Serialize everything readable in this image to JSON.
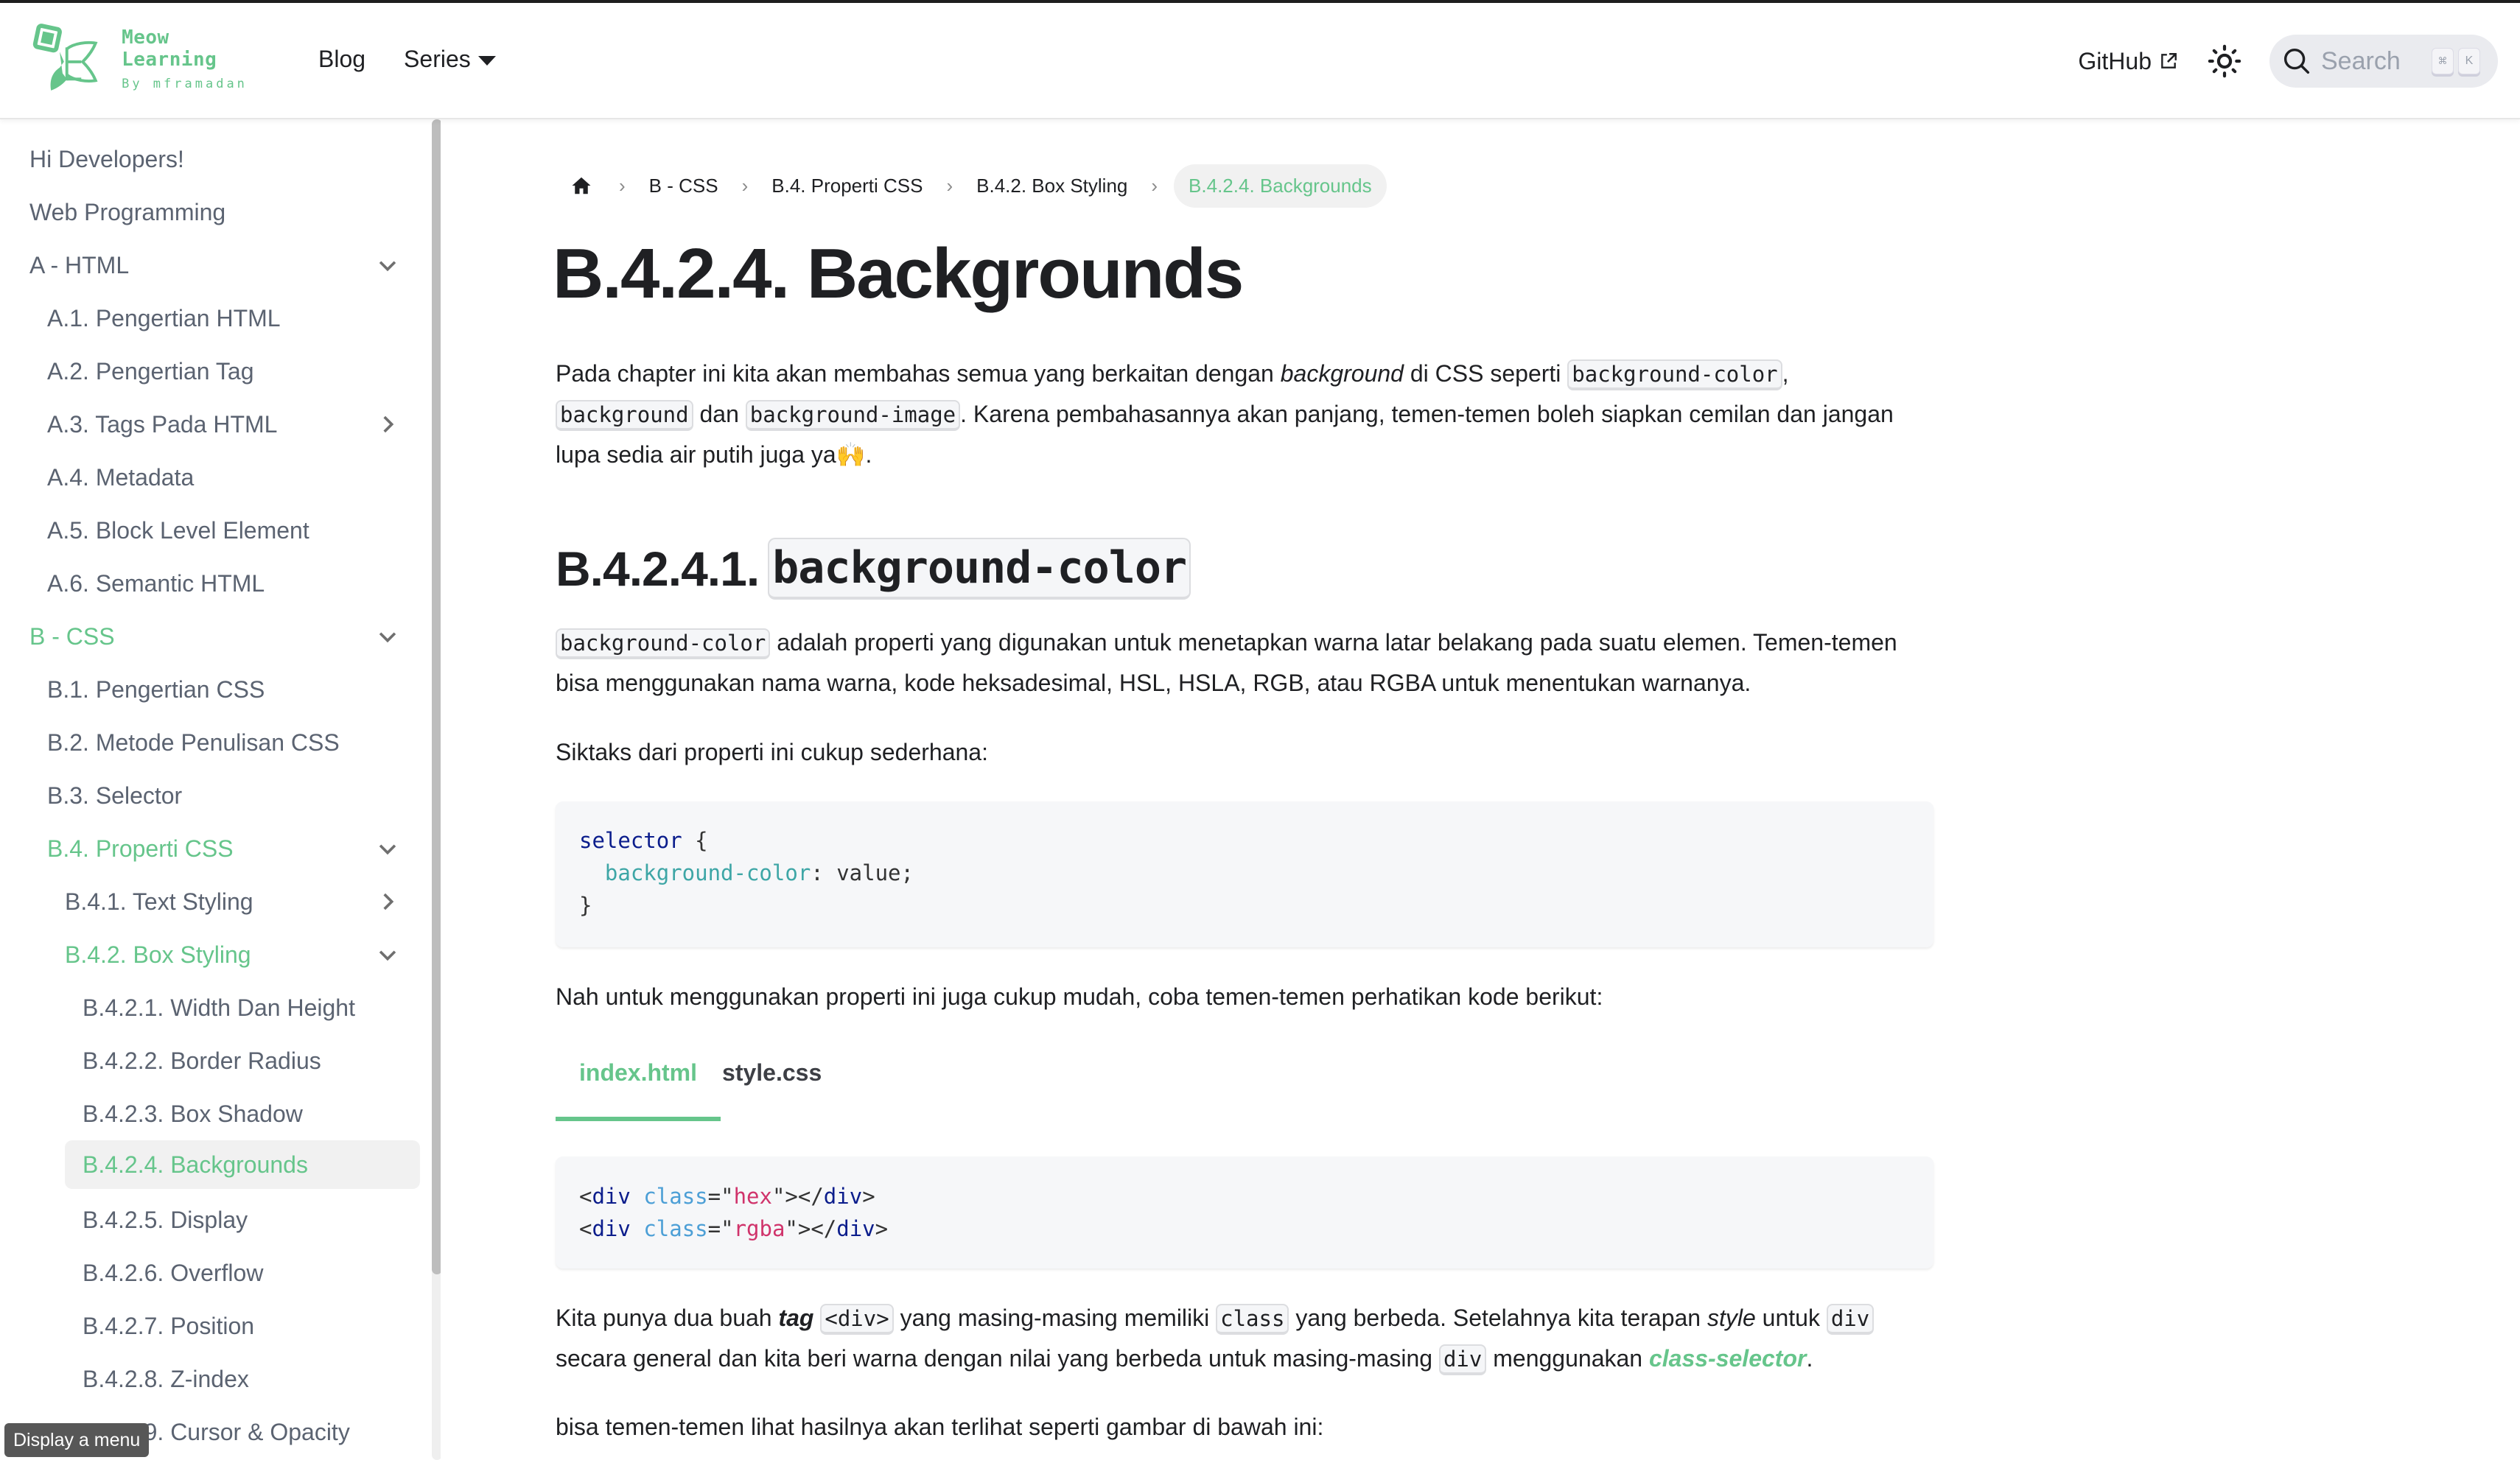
{
  "header": {
    "logo_title": "Meow Learning",
    "logo_subtitle": "By mframadan",
    "nav": {
      "blog": "Blog",
      "series": "Series"
    },
    "github": "GitHub",
    "search": {
      "placeholder": "Search",
      "shortcut_modifier": "⌘",
      "shortcut_key": "K"
    }
  },
  "sidebar": {
    "items": [
      {
        "label": "Hi Developers!"
      },
      {
        "label": "Web Programming"
      },
      {
        "label": "A - HTML",
        "expanded": true
      },
      {
        "label": "A.1. Pengertian HTML"
      },
      {
        "label": "A.2. Pengertian Tag"
      },
      {
        "label": "A.3. Tags Pada HTML",
        "expanded": false
      },
      {
        "label": "A.4. Metadata"
      },
      {
        "label": "A.5. Block Level Element"
      },
      {
        "label": "A.6. Semantic HTML"
      },
      {
        "label": "B - CSS",
        "expanded": true,
        "highlighted": true
      },
      {
        "label": "B.1. Pengertian CSS"
      },
      {
        "label": "B.2. Metode Penulisan CSS"
      },
      {
        "label": "B.3. Selector"
      },
      {
        "label": "B.4. Properti CSS",
        "expanded": true,
        "highlighted": true
      },
      {
        "label": "B.4.1. Text Styling",
        "expanded": false
      },
      {
        "label": "B.4.2. Box Styling",
        "expanded": true,
        "highlighted": true
      },
      {
        "label": "B.4.2.1. Width Dan Height"
      },
      {
        "label": "B.4.2.2. Border Radius"
      },
      {
        "label": "B.4.2.3. Box Shadow"
      },
      {
        "label": "B.4.2.4. Backgrounds",
        "active": true
      },
      {
        "label": "B.4.2.5. Display"
      },
      {
        "label": "B.4.2.6. Overflow"
      },
      {
        "label": "B.4.2.7. Position"
      },
      {
        "label": "B.4.2.8. Z-index"
      },
      {
        "label": "B.4.2.9. Cursor & Opacity"
      }
    ]
  },
  "tooltip": "Display a menu",
  "breadcrumb": {
    "items": [
      "B - CSS",
      "B.4. Properti CSS",
      "B.4.2. Box Styling"
    ],
    "current": "B.4.2.4. Backgrounds",
    "separator": "›"
  },
  "article": {
    "title": "B.4.2.4. Backgrounds",
    "intro": {
      "t1": "Pada chapter ini kita akan membahas semua yang berkaitan dengan ",
      "em1": "background",
      "t2": " di CSS seperti ",
      "c1": "background-color",
      "t3": ",",
      "c2": "background",
      "t4": " dan ",
      "c3": "background-image",
      "t5": ". Karena pembahasannya akan panjang, temen-temen boleh siapkan cemilan dan jangan",
      "t6": "lupa sedia air putih juga ya",
      "emoji": "🙌",
      "t7": "."
    },
    "section1": {
      "number": "B.4.2.4.1.",
      "code": "background-color"
    },
    "para1": {
      "c1": "background-color",
      "t1": " adalah properti yang digunakan untuk menetapkan warna latar belakang pada suatu elemen. Temen-temen",
      "t2": "bisa menggunakan nama warna, kode heksadesimal, HSL, HSLA, RGB, atau RGBA untuk menentukan warnanya."
    },
    "para2": "Siktaks dari properti ini cukup sederhana:",
    "code1": {
      "selector": "selector",
      "open": " {",
      "property": "background-color",
      "rest": ": value;",
      "close": "}"
    },
    "para3": "Nah untuk menggunakan properti ini juga cukup mudah, coba temen-temen perhatikan kode berikut:",
    "tabs": [
      {
        "label": "index.html",
        "active": true
      },
      {
        "label": "style.css",
        "active": false
      }
    ],
    "code2": {
      "lines": [
        {
          "tag": "div",
          "attr": "class",
          "value": "hex"
        },
        {
          "tag": "div",
          "attr": "class",
          "value": "rgba"
        }
      ]
    },
    "para4": {
      "t1": "Kita punya dua buah ",
      "b1": "tag",
      "c1": "<div>",
      "t2": " yang masing-masing memiliki ",
      "c2": "class",
      "t3": " yang berbeda. Setelahnya kita terapan ",
      "em1": "style",
      "t4": " untuk ",
      "c3": "div",
      "t5": "secara general dan kita beri warna dengan nilai yang berbeda untuk masing-masing ",
      "c4": "div",
      "t6": " menggunakan ",
      "link": "class-selector",
      "t7": "."
    },
    "para5": "bisa temen-temen lihat hasilnya akan terlihat seperti gambar di bawah ini:"
  },
  "colors": {
    "accent": "#66c58b",
    "text": "#1f2023",
    "sidebar_text": "#5b6371"
  }
}
